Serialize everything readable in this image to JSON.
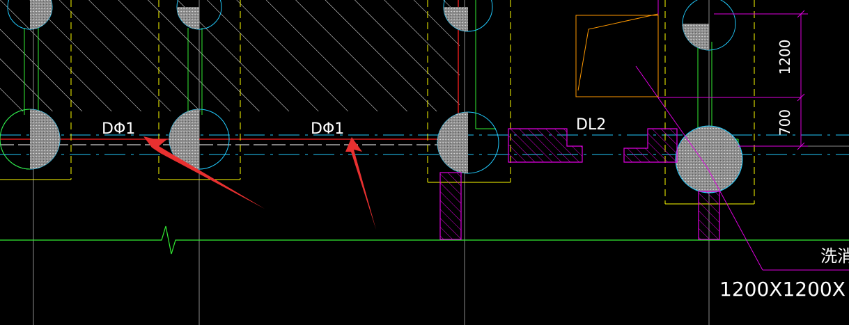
{
  "drawing": {
    "beam_labels": [
      "DΦ1",
      "DΦ1",
      "DL2"
    ],
    "dimensions": [
      "1200",
      "700"
    ],
    "note_text": "洗消",
    "size_text": "1200X1200X"
  },
  "colors": {
    "background": "#000000",
    "hatch": "#ffffff",
    "column_fill": "#9a9a9a",
    "outline_yellow": "#ffff00",
    "outline_green": "#33ee33",
    "outline_cyan": "#22ccff",
    "outline_magenta": "#e000e0",
    "axis_red": "#ff2020",
    "grid_grey": "#8a8a8a",
    "orange": "#ff9900",
    "arrow_red": "#e83030"
  }
}
